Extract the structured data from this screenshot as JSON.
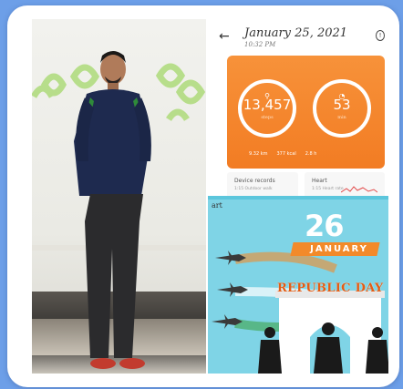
{
  "collage": {
    "photo": {
      "subject": "person standing in front of wall"
    },
    "phone": {
      "date": "January 25, 2021",
      "time": "10:32 PM",
      "steps_value": "13,457",
      "steps_unit": "steps",
      "second_value": "53",
      "second_unit": "min",
      "stats": [
        "9.32 km",
        "377 kcal",
        "2.8 h"
      ],
      "card1_title": "Device records",
      "card1_sub": "1:15 Outdoor walk",
      "card2_title": "Heart",
      "card2_sub": "1:15 Heart rate",
      "colors": {
        "accent": "#f27c23"
      }
    },
    "republic_day": {
      "corner_text": "art",
      "day": "26",
      "month": "JANUARY",
      "title": "REPUBLIC DAY",
      "colors": {
        "sky": "#7fd4e6",
        "ribbon": "#f28a2a",
        "title": "#e45c14"
      }
    }
  }
}
